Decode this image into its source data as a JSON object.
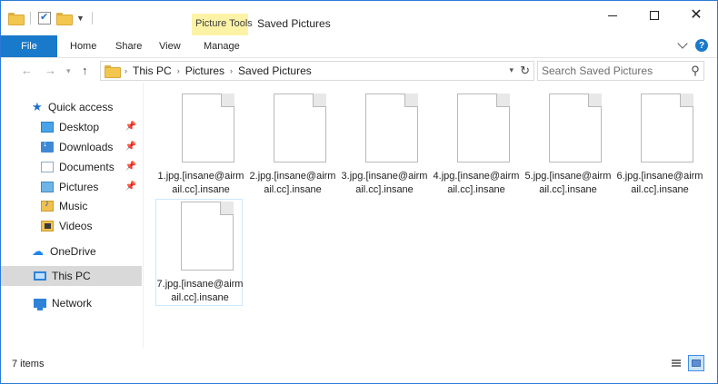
{
  "window": {
    "title": "Saved Pictures",
    "context_tab": "Picture Tools"
  },
  "ribbon": {
    "tabs": [
      "File",
      "Home",
      "Share",
      "View",
      "Manage"
    ]
  },
  "address": {
    "crumbs": [
      "This PC",
      "Pictures",
      "Saved Pictures"
    ],
    "search_placeholder": "Search Saved Pictures"
  },
  "sidebar": {
    "quick_access": "Quick access",
    "pinned": [
      {
        "label": "Desktop",
        "icon": "desktop-icon"
      },
      {
        "label": "Downloads",
        "icon": "downloads-icon"
      },
      {
        "label": "Documents",
        "icon": "documents-icon"
      },
      {
        "label": "Pictures",
        "icon": "pictures-icon"
      }
    ],
    "unpinned": [
      {
        "label": "Music",
        "icon": "music-icon"
      },
      {
        "label": "Videos",
        "icon": "videos-icon"
      }
    ],
    "onedrive": "OneDrive",
    "this_pc": "This PC",
    "network": "Network"
  },
  "files": [
    {
      "name": "1.jpg.[insane@airmail.cc].insane"
    },
    {
      "name": "2.jpg.[insane@airmail.cc].insane"
    },
    {
      "name": "3.jpg.[insane@airmail.cc].insane"
    },
    {
      "name": "4.jpg.[insane@airmail.cc].insane"
    },
    {
      "name": "5.jpg.[insane@airmail.cc].insane"
    },
    {
      "name": "6.jpg.[insane@airmail.cc].insane"
    },
    {
      "name": "7.jpg.[insane@airmail.cc].insane"
    }
  ],
  "status": {
    "item_count": "7 items"
  },
  "colors": {
    "accent": "#1979ca",
    "context_tab_bg": "#fdf3a6",
    "selected_bg": "#d9d9d9"
  }
}
